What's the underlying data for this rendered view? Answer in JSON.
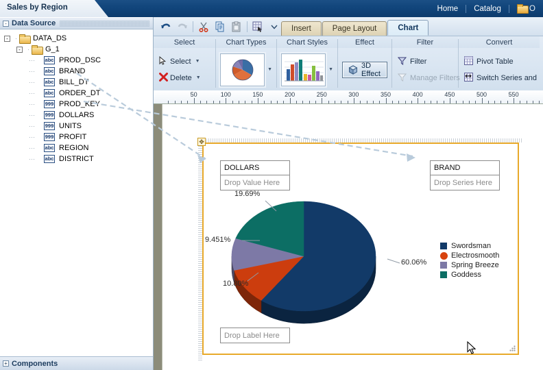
{
  "window": {
    "document_tab": "Sales by Region",
    "top_links": [
      "Home",
      "Catalog"
    ],
    "top_folder_icon": "folder-icon"
  },
  "left_panel": {
    "header": "Data Source",
    "header_expander": "-",
    "footer": "Components",
    "footer_expander": "+",
    "tree": [
      {
        "label": "DATA_DS",
        "type": "folder",
        "indent": 0,
        "expander": "-"
      },
      {
        "label": "G_1",
        "type": "folder",
        "indent": 1,
        "expander": "-"
      },
      {
        "label": "PROD_DSC",
        "type": "abc",
        "indent": 2,
        "expander": ""
      },
      {
        "label": "BRAND",
        "type": "abc",
        "indent": 2,
        "expander": ""
      },
      {
        "label": "BILL_DT",
        "type": "abc",
        "indent": 2,
        "expander": ""
      },
      {
        "label": "ORDER_DT",
        "type": "abc",
        "indent": 2,
        "expander": ""
      },
      {
        "label": "PROD_KEY",
        "type": "999",
        "indent": 2,
        "expander": ""
      },
      {
        "label": "DOLLARS",
        "type": "999",
        "indent": 2,
        "expander": ""
      },
      {
        "label": "UNITS",
        "type": "999",
        "indent": 2,
        "expander": ""
      },
      {
        "label": "PROFIT",
        "type": "999",
        "indent": 2,
        "expander": ""
      },
      {
        "label": "REGION",
        "type": "abc",
        "indent": 2,
        "expander": ""
      },
      {
        "label": "DISTRICT",
        "type": "abc",
        "indent": 2,
        "expander": ""
      }
    ]
  },
  "ribbon": {
    "quick_access": [
      "undo-icon",
      "redo-icon",
      "cut-icon",
      "copy-icon",
      "paste-icon",
      "paste-special-icon",
      "chevron-down-icon"
    ],
    "tabs": [
      {
        "label": "Insert",
        "active": false
      },
      {
        "label": "Page Layout",
        "active": false
      },
      {
        "label": "Chart",
        "active": true
      }
    ],
    "groups": [
      {
        "title": "Select",
        "items": [
          {
            "label": "Select",
            "icon": "pointer-icon",
            "enabled": true,
            "has_caret": true
          },
          {
            "label": "Delete",
            "icon": "delete-x-icon",
            "enabled": true,
            "has_caret": true
          }
        ]
      },
      {
        "title": "Chart Types",
        "items": [
          {
            "label": "",
            "icon": "pie-chart-thumbnail",
            "enabled": true,
            "has_caret": true
          }
        ]
      },
      {
        "title": "Chart Styles",
        "items": [
          {
            "label": "",
            "icon": "bar-chart-thumbnail",
            "enabled": true,
            "has_caret": true
          }
        ]
      },
      {
        "title": "Effect",
        "items": [
          {
            "label": "3D Effect",
            "icon": "cube-icon",
            "enabled": true,
            "pressed": true
          }
        ]
      },
      {
        "title": "Filter",
        "items": [
          {
            "label": "Filter",
            "icon": "funnel-icon",
            "enabled": true
          },
          {
            "label": "Manage Filters",
            "icon": "funnel-outline-icon",
            "enabled": false
          }
        ]
      },
      {
        "title": "Convert",
        "items": [
          {
            "label": "Pivot Table",
            "icon": "pivot-table-icon",
            "enabled": true
          },
          {
            "label": "Switch Series and",
            "icon": "switch-series-icon",
            "enabled": true
          }
        ]
      }
    ]
  },
  "ruler": {
    "ticks": [
      50,
      100,
      150,
      200,
      250,
      300,
      350,
      400,
      450,
      500,
      550
    ],
    "unit_step": 10
  },
  "chart_canvas": {
    "value_dropzone": {
      "field": "DOLLARS",
      "placeholder": "Drop Value Here"
    },
    "series_dropzone": {
      "field": "BRAND",
      "placeholder": "Drop Series Here"
    },
    "label_dropzone": {
      "placeholder": "Drop Label Here"
    },
    "move_handle_icon": "move-cross-icon",
    "resize_grip_icon": "resize-grip-icon",
    "cursor_icon": "mouse-pointer-icon"
  },
  "chart_data": {
    "type": "pie",
    "title": "",
    "value_field": "DOLLARS",
    "series_field": "BRAND",
    "legend_position": "right",
    "effect_3d": true,
    "categories": [
      "Swordsman",
      "Electrosmooth",
      "Spring Breeze",
      "Goddess"
    ],
    "values": [
      60.06,
      10.8,
      9.451,
      19.69
    ],
    "data_labels": [
      "60.06%",
      "10.80%",
      "9.451%",
      "19.69%"
    ],
    "colors": [
      "#123a68",
      "#cc3d0e",
      "#7d79a6",
      "#0c6e64"
    ],
    "legend": [
      {
        "name": "Swordsman",
        "color": "#123a68",
        "marker": "square"
      },
      {
        "name": "Electrosmooth",
        "color": "#d8430f",
        "marker": "circle"
      },
      {
        "name": "Spring Breeze",
        "color": "#7d79a6",
        "marker": "square"
      },
      {
        "name": "Goddess",
        "color": "#0c6e64",
        "marker": "square"
      }
    ]
  }
}
